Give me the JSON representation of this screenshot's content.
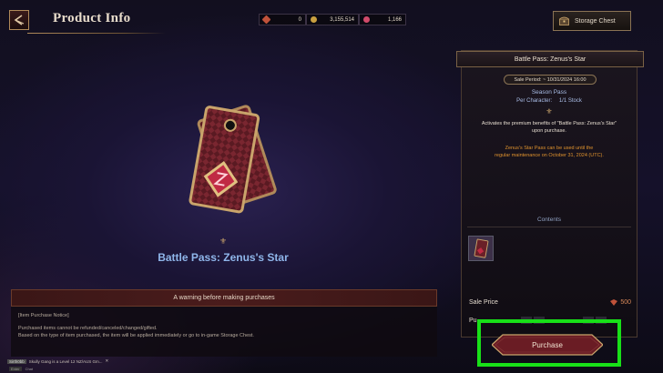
{
  "header": {
    "title": "Product Info"
  },
  "currencies": [
    {
      "icon": "red-gem-icon",
      "value": "0",
      "color": "#c0523a"
    },
    {
      "icon": "gold-coin-icon",
      "value": "3,155,514",
      "color": "#c9a040"
    },
    {
      "icon": "pink-crystal-icon",
      "value": "1,166",
      "color": "#d04a6a"
    }
  ],
  "storage_button": {
    "label": "Storage Chest"
  },
  "item": {
    "name": "Battle Pass: Zenus's Star"
  },
  "warning": {
    "header": "A warning before making purchases",
    "lines": [
      "[Item Purchase Notice]",
      "Purchased items cannot be refunded/canceled/changed/gifted.",
      "Based on the type of item purchased, the item will be applied immediately or go to in-game Storage Chest."
    ]
  },
  "panel": {
    "title": "Battle Pass: Zenus's Star",
    "sale_period": "Sale Period: ~ 10/31/2024 16:00",
    "pass_type": "Season Pass",
    "per_character_label": "Per Character:",
    "per_character_value": "1/1 Stock",
    "description_1": "Activates the premium benefits of \"Battle Pass: Zenus's Star\"",
    "description_2": "upon purchase.",
    "notice_1": "Zenus's Star Pass can be used until the",
    "notice_2": "regular maintenance on October 31, 2024 (UTC).",
    "contents_label": "Contents",
    "sale_price_label": "Sale Price",
    "sale_price_value": "500",
    "purchase_qty_label": "Pu"
  },
  "purchase_button": {
    "label": "Purchase"
  },
  "chat": {
    "tag": "Sirth0bb",
    "message": "Skully Gang is a Level 12 NZ/AUS Gm...",
    "keys": [
      "Enter",
      "Chat"
    ]
  },
  "colors": {
    "accent_gold": "#c9a46b",
    "item_name_blue": "#8fb6ea",
    "notice_orange": "#e0922e",
    "highlight_green": "#18e018"
  }
}
